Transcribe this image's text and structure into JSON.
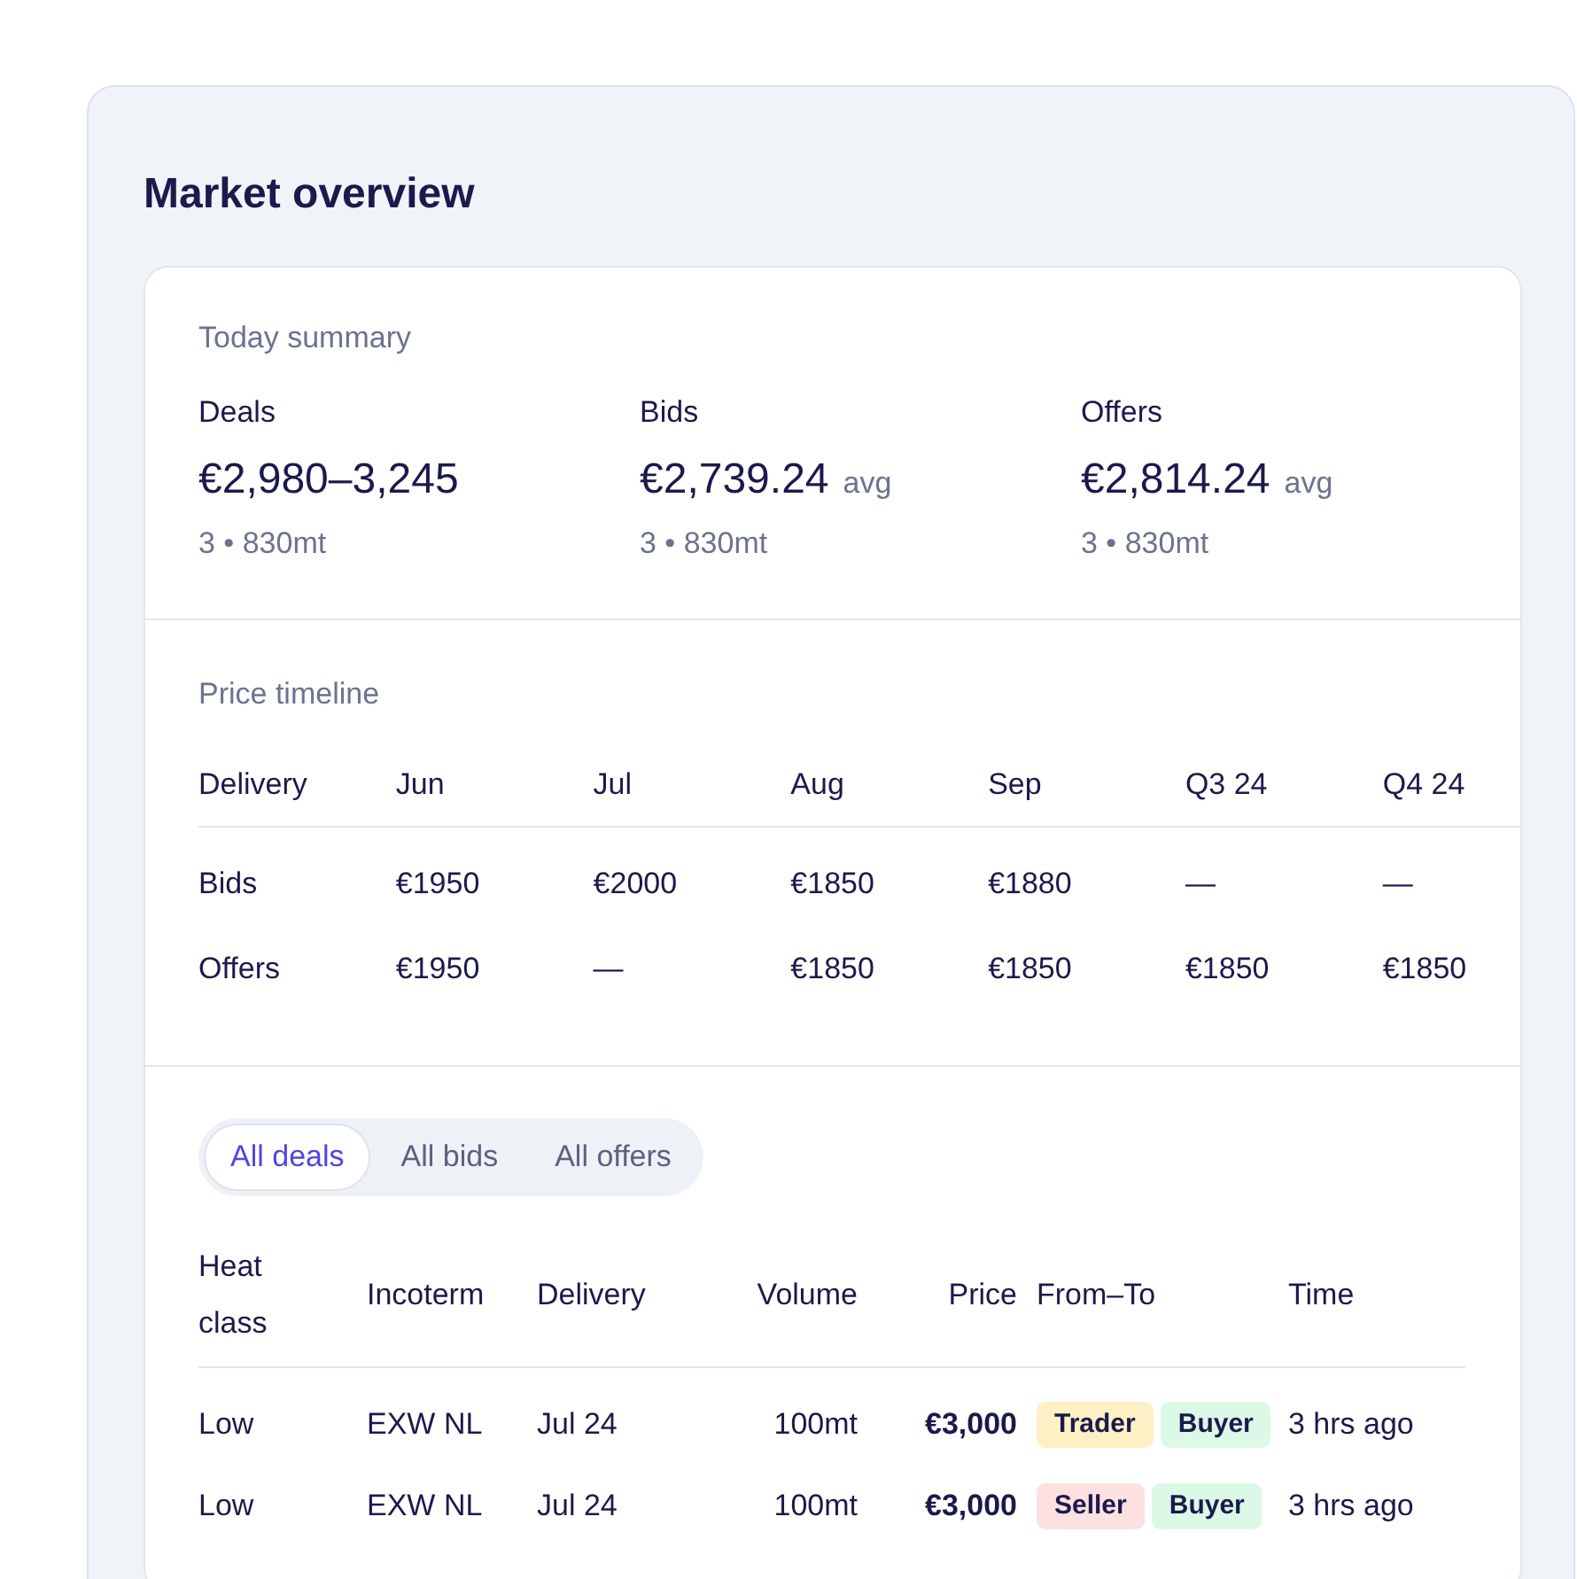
{
  "page": {
    "title": "Market overview"
  },
  "summary": {
    "heading": "Today summary",
    "metrics": [
      {
        "label": "Deals",
        "value": "€2,980–3,245",
        "detail": "3 • 830mt"
      },
      {
        "label": "Bids",
        "value": "€2,739.24",
        "suffix": "avg",
        "detail": "3 • 830mt"
      },
      {
        "label": "Offers",
        "value": "€2,814.24",
        "suffix": "avg",
        "detail": "3 • 830mt"
      }
    ]
  },
  "timeline": {
    "heading": "Price timeline",
    "columns": [
      "Delivery",
      "Jun",
      "Jul",
      "Aug",
      "Sep",
      "Q3 24",
      "Q4 24"
    ],
    "rows": [
      [
        "Bids",
        "€1950",
        "€2000",
        "€1850",
        "€1880",
        "—",
        "—"
      ],
      [
        "Offers",
        "€1950",
        "—",
        "€1850",
        "€1850",
        "€1850",
        "€1850"
      ]
    ]
  },
  "deals": {
    "tabs": [
      {
        "label": "All deals",
        "selected": true
      },
      {
        "label": "All bids",
        "selected": false
      },
      {
        "label": "All offers",
        "selected": false
      }
    ],
    "columns": [
      "Heat class",
      "Incoterm",
      "Delivery",
      "Volume",
      "Price",
      "From–To",
      "Time"
    ],
    "rows": [
      {
        "heat_class": "Low",
        "incoterm": "EXW NL",
        "delivery": "Jul 24",
        "volume": "100mt",
        "price": "€3,000",
        "tags": [
          {
            "label": "Trader",
            "color": "#fdf0c4"
          },
          {
            "label": "Buyer",
            "color": "#dcf8e6"
          }
        ],
        "time": "3 hrs ago"
      },
      {
        "heat_class": "Low",
        "incoterm": "EXW NL",
        "delivery": "Jul 24",
        "volume": "100mt",
        "price": "€3,000",
        "tags": [
          {
            "label": "Seller",
            "color": "#fde0e0"
          },
          {
            "label": "Buyer",
            "color": "#dcf8e6"
          }
        ],
        "time": "3 hrs ago"
      }
    ]
  }
}
